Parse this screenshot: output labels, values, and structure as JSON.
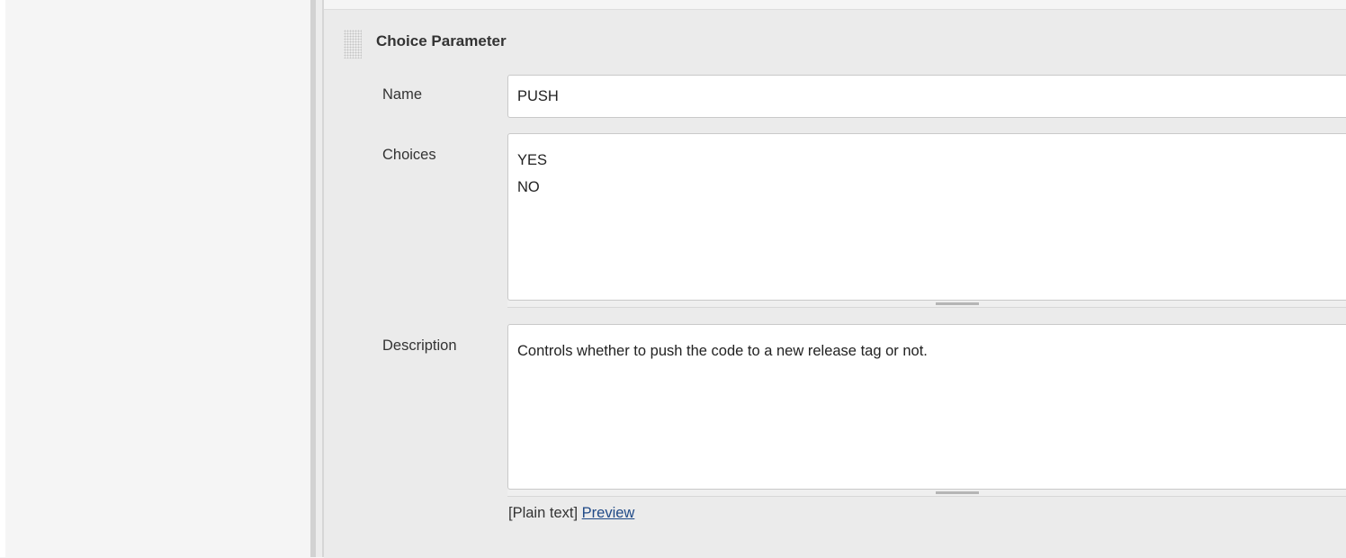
{
  "parameter": {
    "title": "Choice Parameter",
    "name_label": "Name",
    "name_value": "PUSH",
    "choices_label": "Choices",
    "choices_value": "YES\nNO",
    "description_label": "Description",
    "description_value": "Controls whether to push the code to a new release tag or not.",
    "format_text": "[Plain text]",
    "preview_link": "Preview"
  },
  "colors": {
    "panel_background": "#ebebeb",
    "link": "#204a87"
  },
  "icons": {
    "drag_handle": "grip-dots-icon"
  }
}
